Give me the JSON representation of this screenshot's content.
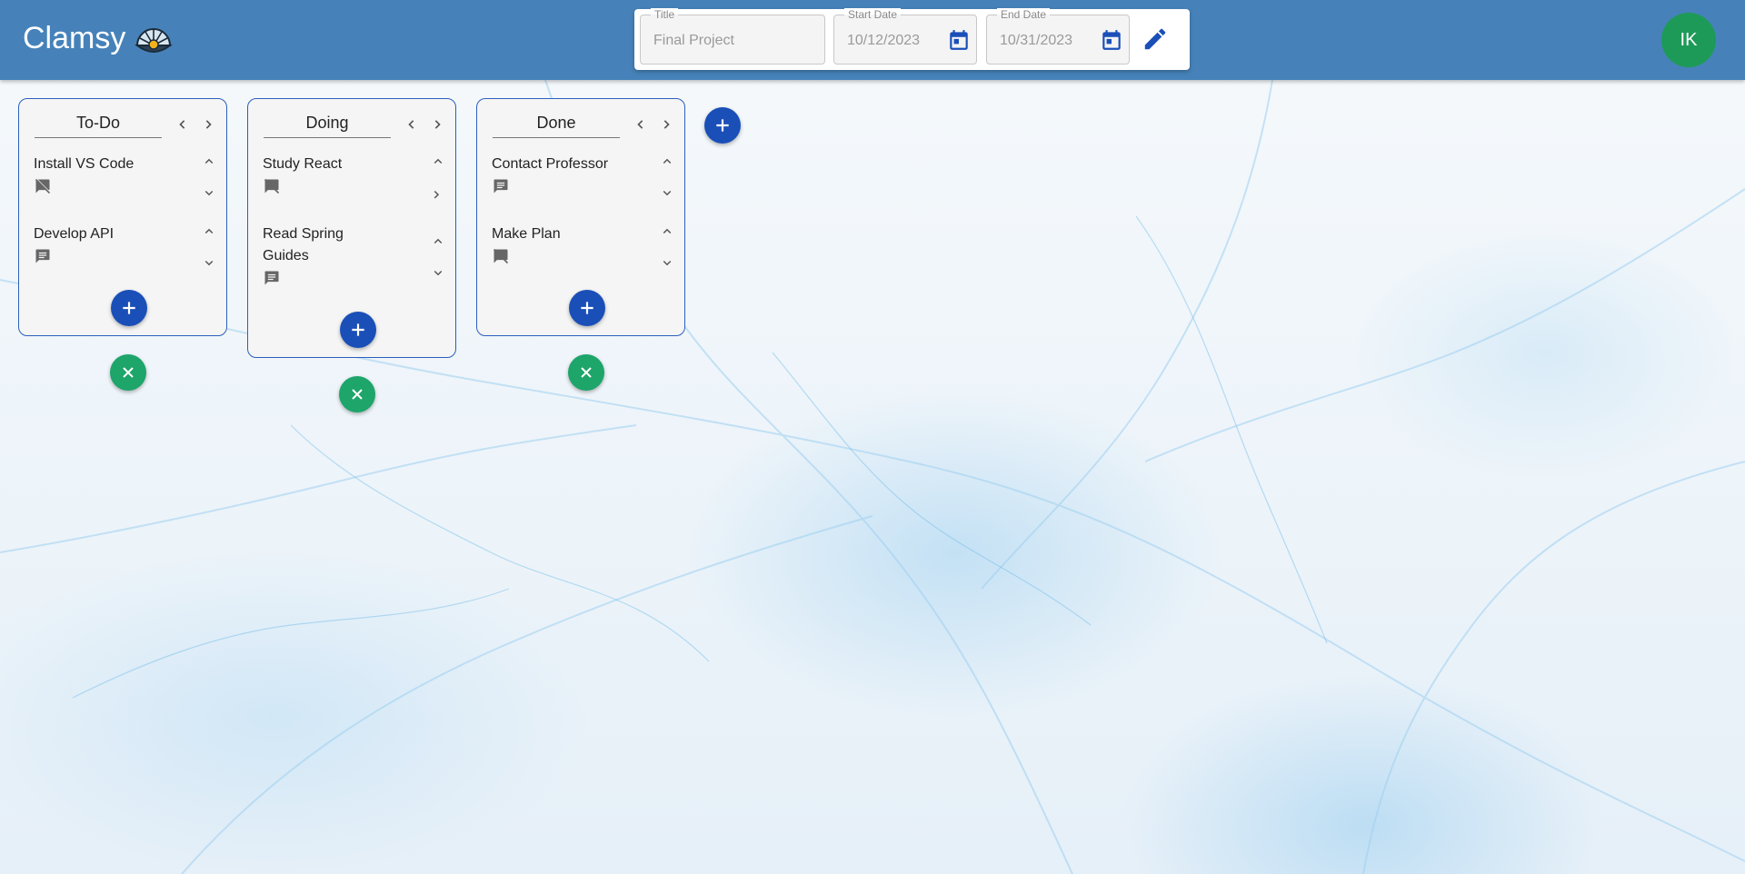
{
  "app": {
    "name": "Clamsy",
    "logo_icon": "clam-shell-icon"
  },
  "project": {
    "title_label": "Title",
    "title_value": "Final Project",
    "start_label": "Start Date",
    "start_value": "10/12/2023",
    "end_label": "End Date",
    "end_value": "10/31/2023",
    "icons": {
      "calendar": "calendar-icon",
      "edit": "pencil-edit-icon"
    }
  },
  "user": {
    "initials": "IK",
    "avatar_color": "#1e9a58"
  },
  "colors": {
    "appbar": "#4682b9",
    "primary": "#1a4fb8",
    "success": "#1da56a",
    "column_border": "#2b5fbd"
  },
  "columns": [
    {
      "title": "To-Do",
      "tasks": [
        {
          "title": "Install VS Code",
          "has_comments": false
        },
        {
          "title": "Develop API",
          "has_comments": true
        }
      ]
    },
    {
      "title": "Doing",
      "tasks": [
        {
          "title": "Study React",
          "has_comments": false
        },
        {
          "title": "Read Spring Guides",
          "has_comments": true
        }
      ]
    },
    {
      "title": "Done",
      "tasks": [
        {
          "title": "Contact Professor",
          "has_comments": true
        },
        {
          "title": "Make Plan",
          "has_comments": false
        }
      ]
    }
  ]
}
